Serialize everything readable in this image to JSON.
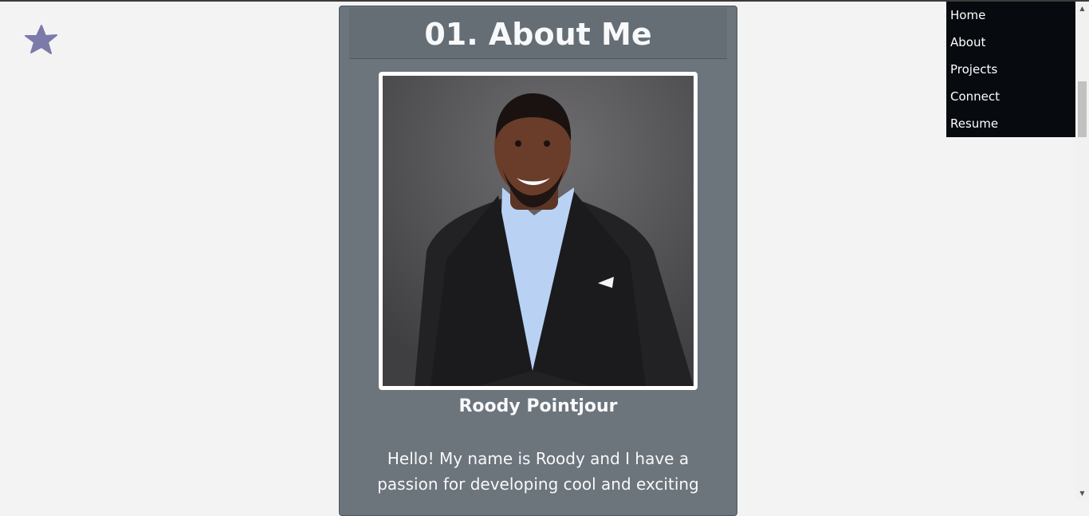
{
  "logo": {
    "icon": "star-icon",
    "color": "#7b7aa8"
  },
  "about": {
    "title": "01. About Me",
    "photo_alt": "Portrait of Roody Pointjour",
    "name": "Roody Pointjour",
    "bio": "Hello! My name is Roody and I have a passion for developing cool and exciting"
  },
  "nav": {
    "items": [
      {
        "label": "Home"
      },
      {
        "label": "About"
      },
      {
        "label": "Projects"
      },
      {
        "label": "Connect"
      },
      {
        "label": "Resume"
      }
    ]
  },
  "scrollbar": {
    "up_icon": "chevron-up-icon",
    "down_icon": "chevron-down-icon"
  },
  "colors": {
    "page_bg": "#f3f3f3",
    "card_bg": "#6c747c",
    "nav_bg": "#070b10",
    "text_light": "#f8f9fa"
  }
}
